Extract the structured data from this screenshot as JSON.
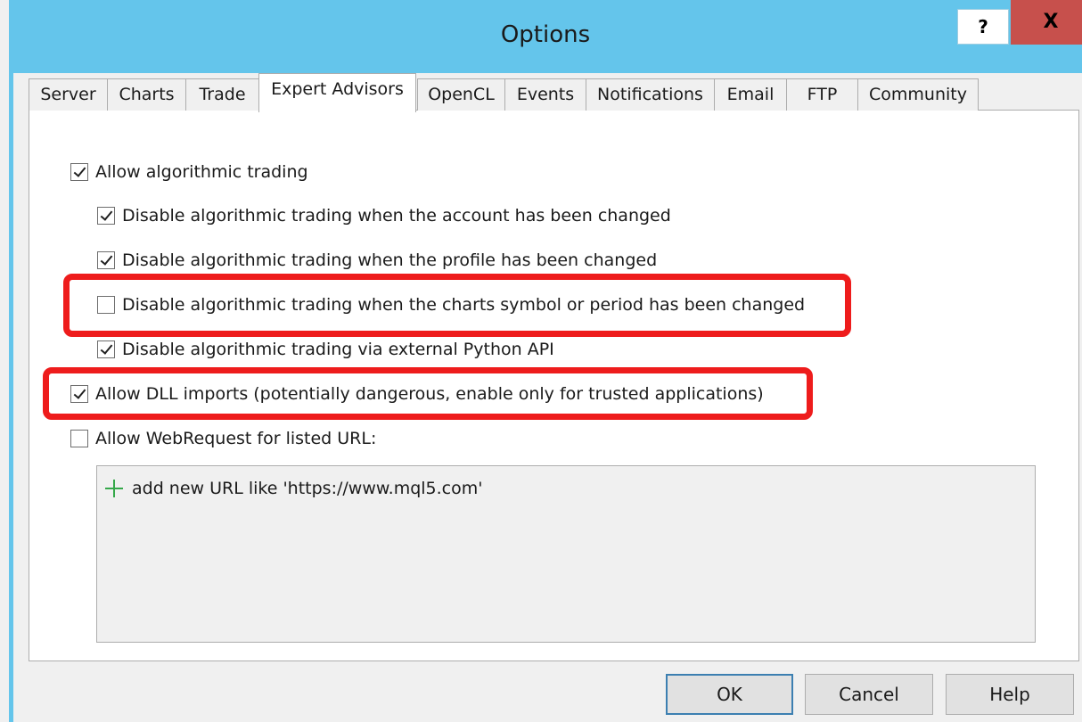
{
  "window": {
    "title": "Options",
    "help_label": "?",
    "close_label": "X"
  },
  "tabs": [
    {
      "label": "Server"
    },
    {
      "label": "Charts"
    },
    {
      "label": "Trade"
    },
    {
      "label": "Expert Advisors",
      "active": true
    },
    {
      "label": "OpenCL"
    },
    {
      "label": "Events"
    },
    {
      "label": "Notifications"
    },
    {
      "label": "Email"
    },
    {
      "label": "FTP"
    },
    {
      "label": "Community"
    }
  ],
  "options": {
    "allow_algo": {
      "label": "Allow algorithmic trading",
      "checked": true
    },
    "disable_account": {
      "label": "Disable algorithmic trading when the account has been changed",
      "checked": true
    },
    "disable_profile": {
      "label": "Disable algorithmic trading when the profile has been changed",
      "checked": true
    },
    "disable_symbol": {
      "label": "Disable algorithmic trading when the charts symbol or period has been changed",
      "checked": false
    },
    "disable_python": {
      "label": "Disable algorithmic trading via external Python API",
      "checked": true
    },
    "allow_dll": {
      "label": "Allow DLL imports (potentially dangerous, enable only for trusted applications)",
      "checked": true
    },
    "allow_webrequest": {
      "label": "Allow WebRequest for listed URL:",
      "checked": false
    }
  },
  "url_list": {
    "add_label": "add new URL like 'https://www.mql5.com'"
  },
  "buttons": {
    "ok": "OK",
    "cancel": "Cancel",
    "help": "Help"
  },
  "colors": {
    "titlebar": "#64c5eb",
    "close": "#c7504c",
    "highlight": "#ee1c1c",
    "plus": "#35a84a"
  }
}
